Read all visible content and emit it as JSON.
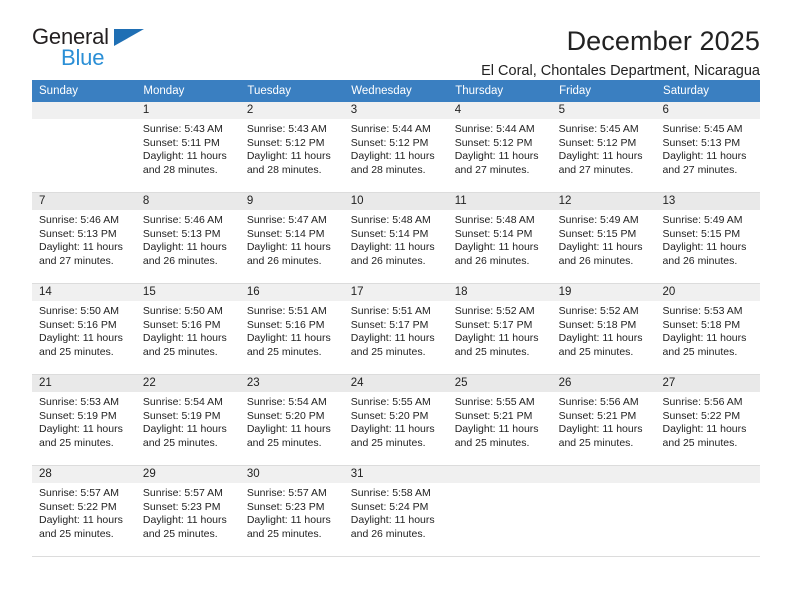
{
  "brand": {
    "name_top": "General",
    "name_bottom": "Blue",
    "triangle_color": "#1f6fb4",
    "blue_color": "#2b8fd6"
  },
  "header": {
    "title": "December 2025",
    "subtitle": "El Coral, Chontales Department, Nicaragua"
  },
  "calendar": {
    "header_color": "#3a7fc1",
    "weekday_headers": [
      "Sunday",
      "Monday",
      "Tuesday",
      "Wednesday",
      "Thursday",
      "Friday",
      "Saturday"
    ],
    "weeks": [
      [
        {
          "day": "",
          "sunrise": "",
          "sunset": "",
          "daylight_line1": "",
          "daylight_line2": ""
        },
        {
          "day": "1",
          "sunrise": "Sunrise: 5:43 AM",
          "sunset": "Sunset: 5:11 PM",
          "daylight_line1": "Daylight: 11 hours",
          "daylight_line2": "and 28 minutes."
        },
        {
          "day": "2",
          "sunrise": "Sunrise: 5:43 AM",
          "sunset": "Sunset: 5:12 PM",
          "daylight_line1": "Daylight: 11 hours",
          "daylight_line2": "and 28 minutes."
        },
        {
          "day": "3",
          "sunrise": "Sunrise: 5:44 AM",
          "sunset": "Sunset: 5:12 PM",
          "daylight_line1": "Daylight: 11 hours",
          "daylight_line2": "and 28 minutes."
        },
        {
          "day": "4",
          "sunrise": "Sunrise: 5:44 AM",
          "sunset": "Sunset: 5:12 PM",
          "daylight_line1": "Daylight: 11 hours",
          "daylight_line2": "and 27 minutes."
        },
        {
          "day": "5",
          "sunrise": "Sunrise: 5:45 AM",
          "sunset": "Sunset: 5:12 PM",
          "daylight_line1": "Daylight: 11 hours",
          "daylight_line2": "and 27 minutes."
        },
        {
          "day": "6",
          "sunrise": "Sunrise: 5:45 AM",
          "sunset": "Sunset: 5:13 PM",
          "daylight_line1": "Daylight: 11 hours",
          "daylight_line2": "and 27 minutes."
        }
      ],
      [
        {
          "day": "7",
          "sunrise": "Sunrise: 5:46 AM",
          "sunset": "Sunset: 5:13 PM",
          "daylight_line1": "Daylight: 11 hours",
          "daylight_line2": "and 27 minutes."
        },
        {
          "day": "8",
          "sunrise": "Sunrise: 5:46 AM",
          "sunset": "Sunset: 5:13 PM",
          "daylight_line1": "Daylight: 11 hours",
          "daylight_line2": "and 26 minutes."
        },
        {
          "day": "9",
          "sunrise": "Sunrise: 5:47 AM",
          "sunset": "Sunset: 5:14 PM",
          "daylight_line1": "Daylight: 11 hours",
          "daylight_line2": "and 26 minutes."
        },
        {
          "day": "10",
          "sunrise": "Sunrise: 5:48 AM",
          "sunset": "Sunset: 5:14 PM",
          "daylight_line1": "Daylight: 11 hours",
          "daylight_line2": "and 26 minutes."
        },
        {
          "day": "11",
          "sunrise": "Sunrise: 5:48 AM",
          "sunset": "Sunset: 5:14 PM",
          "daylight_line1": "Daylight: 11 hours",
          "daylight_line2": "and 26 minutes."
        },
        {
          "day": "12",
          "sunrise": "Sunrise: 5:49 AM",
          "sunset": "Sunset: 5:15 PM",
          "daylight_line1": "Daylight: 11 hours",
          "daylight_line2": "and 26 minutes."
        },
        {
          "day": "13",
          "sunrise": "Sunrise: 5:49 AM",
          "sunset": "Sunset: 5:15 PM",
          "daylight_line1": "Daylight: 11 hours",
          "daylight_line2": "and 26 minutes."
        }
      ],
      [
        {
          "day": "14",
          "sunrise": "Sunrise: 5:50 AM",
          "sunset": "Sunset: 5:16 PM",
          "daylight_line1": "Daylight: 11 hours",
          "daylight_line2": "and 25 minutes."
        },
        {
          "day": "15",
          "sunrise": "Sunrise: 5:50 AM",
          "sunset": "Sunset: 5:16 PM",
          "daylight_line1": "Daylight: 11 hours",
          "daylight_line2": "and 25 minutes."
        },
        {
          "day": "16",
          "sunrise": "Sunrise: 5:51 AM",
          "sunset": "Sunset: 5:16 PM",
          "daylight_line1": "Daylight: 11 hours",
          "daylight_line2": "and 25 minutes."
        },
        {
          "day": "17",
          "sunrise": "Sunrise: 5:51 AM",
          "sunset": "Sunset: 5:17 PM",
          "daylight_line1": "Daylight: 11 hours",
          "daylight_line2": "and 25 minutes."
        },
        {
          "day": "18",
          "sunrise": "Sunrise: 5:52 AM",
          "sunset": "Sunset: 5:17 PM",
          "daylight_line1": "Daylight: 11 hours",
          "daylight_line2": "and 25 minutes."
        },
        {
          "day": "19",
          "sunrise": "Sunrise: 5:52 AM",
          "sunset": "Sunset: 5:18 PM",
          "daylight_line1": "Daylight: 11 hours",
          "daylight_line2": "and 25 minutes."
        },
        {
          "day": "20",
          "sunrise": "Sunrise: 5:53 AM",
          "sunset": "Sunset: 5:18 PM",
          "daylight_line1": "Daylight: 11 hours",
          "daylight_line2": "and 25 minutes."
        }
      ],
      [
        {
          "day": "21",
          "sunrise": "Sunrise: 5:53 AM",
          "sunset": "Sunset: 5:19 PM",
          "daylight_line1": "Daylight: 11 hours",
          "daylight_line2": "and 25 minutes."
        },
        {
          "day": "22",
          "sunrise": "Sunrise: 5:54 AM",
          "sunset": "Sunset: 5:19 PM",
          "daylight_line1": "Daylight: 11 hours",
          "daylight_line2": "and 25 minutes."
        },
        {
          "day": "23",
          "sunrise": "Sunrise: 5:54 AM",
          "sunset": "Sunset: 5:20 PM",
          "daylight_line1": "Daylight: 11 hours",
          "daylight_line2": "and 25 minutes."
        },
        {
          "day": "24",
          "sunrise": "Sunrise: 5:55 AM",
          "sunset": "Sunset: 5:20 PM",
          "daylight_line1": "Daylight: 11 hours",
          "daylight_line2": "and 25 minutes."
        },
        {
          "day": "25",
          "sunrise": "Sunrise: 5:55 AM",
          "sunset": "Sunset: 5:21 PM",
          "daylight_line1": "Daylight: 11 hours",
          "daylight_line2": "and 25 minutes."
        },
        {
          "day": "26",
          "sunrise": "Sunrise: 5:56 AM",
          "sunset": "Sunset: 5:21 PM",
          "daylight_line1": "Daylight: 11 hours",
          "daylight_line2": "and 25 minutes."
        },
        {
          "day": "27",
          "sunrise": "Sunrise: 5:56 AM",
          "sunset": "Sunset: 5:22 PM",
          "daylight_line1": "Daylight: 11 hours",
          "daylight_line2": "and 25 minutes."
        }
      ],
      [
        {
          "day": "28",
          "sunrise": "Sunrise: 5:57 AM",
          "sunset": "Sunset: 5:22 PM",
          "daylight_line1": "Daylight: 11 hours",
          "daylight_line2": "and 25 minutes."
        },
        {
          "day": "29",
          "sunrise": "Sunrise: 5:57 AM",
          "sunset": "Sunset: 5:23 PM",
          "daylight_line1": "Daylight: 11 hours",
          "daylight_line2": "and 25 minutes."
        },
        {
          "day": "30",
          "sunrise": "Sunrise: 5:57 AM",
          "sunset": "Sunset: 5:23 PM",
          "daylight_line1": "Daylight: 11 hours",
          "daylight_line2": "and 25 minutes."
        },
        {
          "day": "31",
          "sunrise": "Sunrise: 5:58 AM",
          "sunset": "Sunset: 5:24 PM",
          "daylight_line1": "Daylight: 11 hours",
          "daylight_line2": "and 26 minutes."
        },
        {
          "day": "",
          "sunrise": "",
          "sunset": "",
          "daylight_line1": "",
          "daylight_line2": ""
        },
        {
          "day": "",
          "sunrise": "",
          "sunset": "",
          "daylight_line1": "",
          "daylight_line2": ""
        },
        {
          "day": "",
          "sunrise": "",
          "sunset": "",
          "daylight_line1": "",
          "daylight_line2": ""
        }
      ]
    ]
  }
}
